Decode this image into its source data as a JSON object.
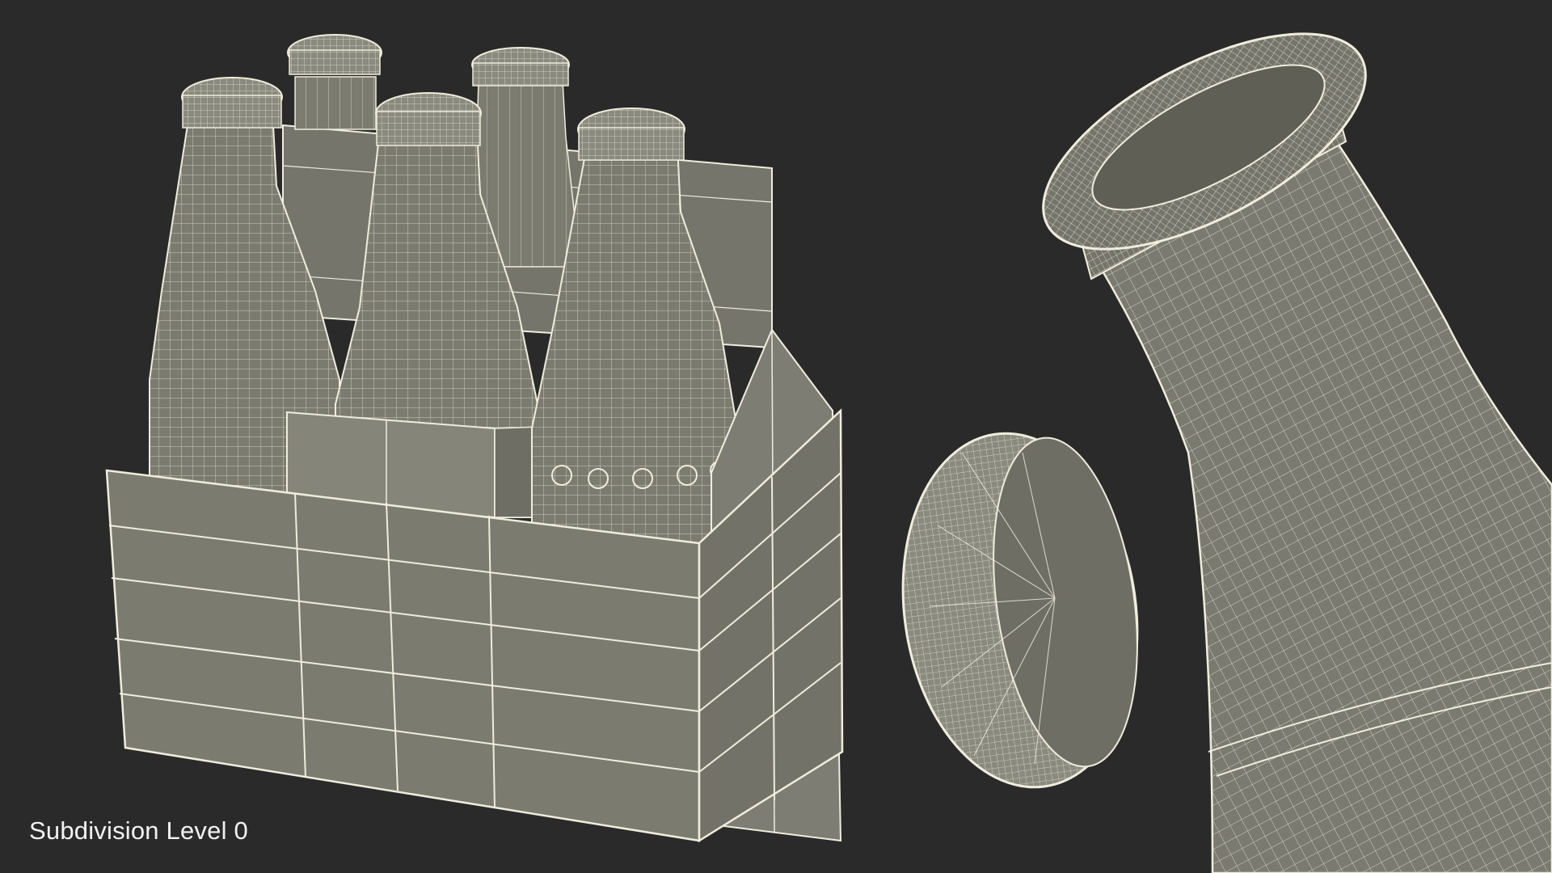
{
  "viewport": {
    "caption": "Subdivision Level 0",
    "background_color": "#2a2a2a",
    "mesh_fill_color": "#7b7b70",
    "wire_color": "#f1efdf"
  },
  "scene": {
    "objects": [
      "six-pack-carrier",
      "bottle",
      "bottle",
      "bottle",
      "bottle",
      "bottle",
      "bottle-cap",
      "bottle-neck-closeup"
    ]
  }
}
